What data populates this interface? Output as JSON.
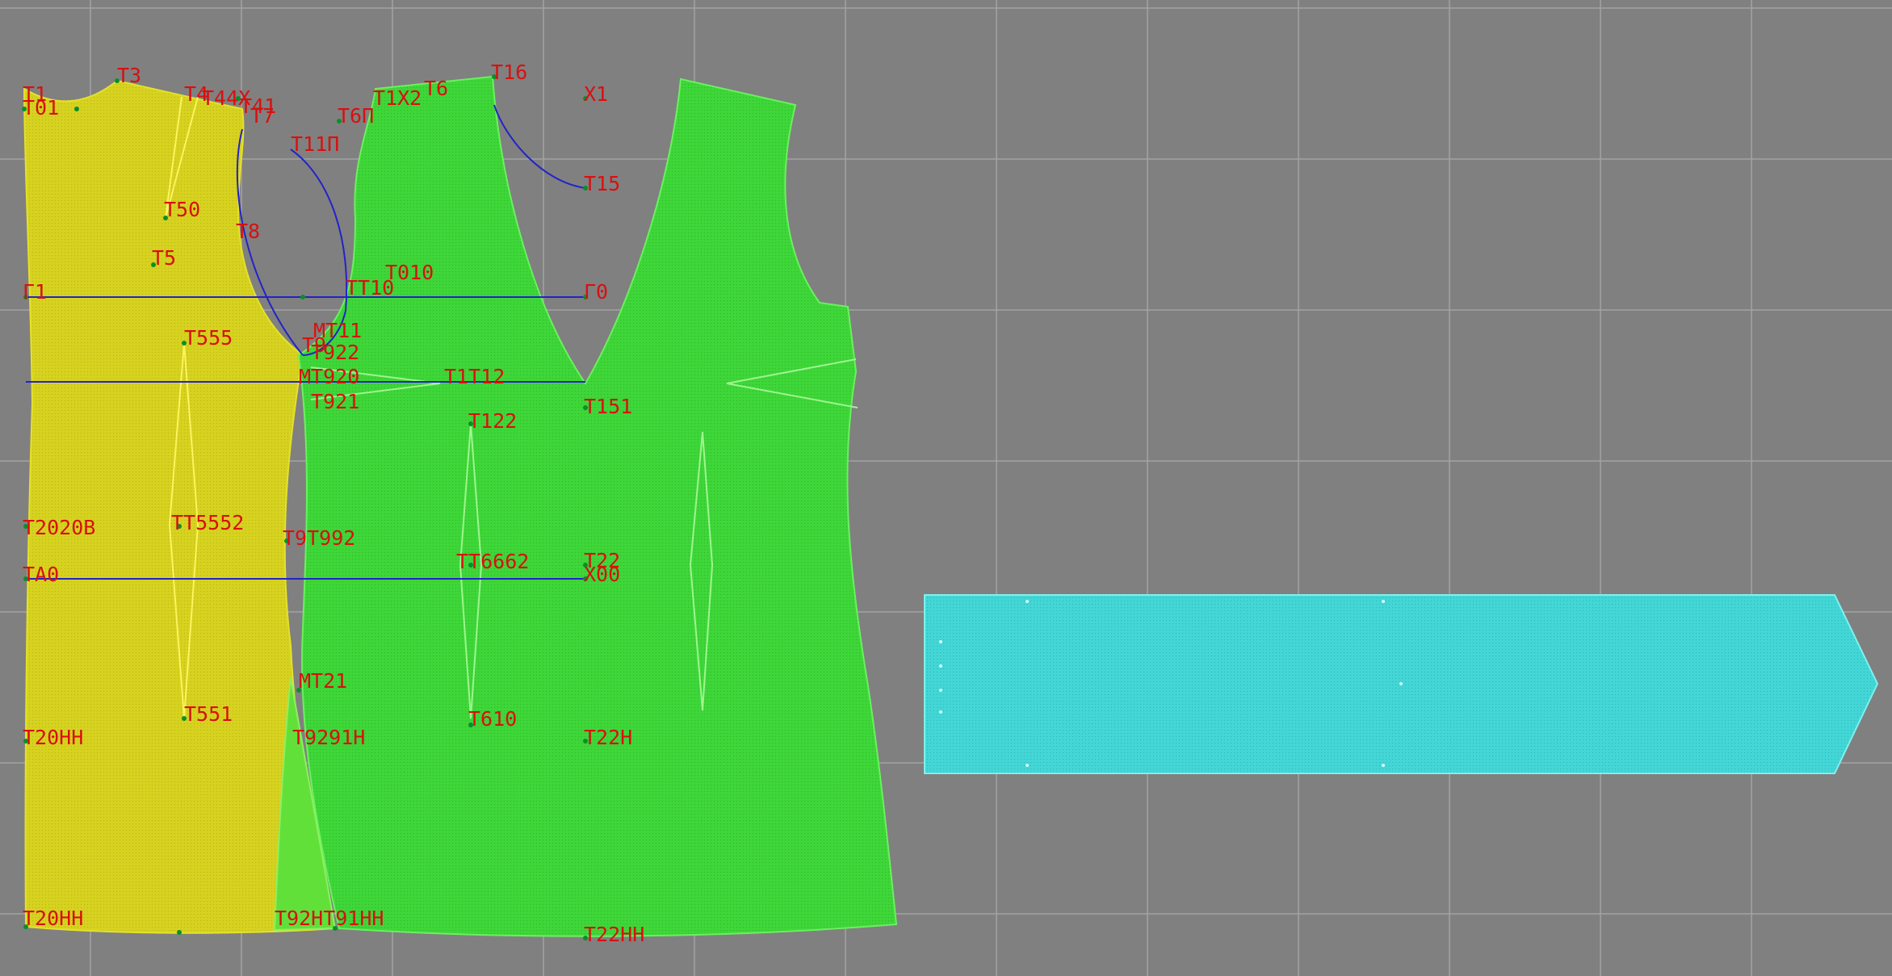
{
  "colors": {
    "background": "#808080",
    "grid": "#a3a3a3",
    "back_piece": "#d6d21f",
    "front_piece": "#3ed638",
    "band_piece": "#43d6d6",
    "construction_line": "#2323c8",
    "label": "#d81010"
  },
  "labels": {
    "t1": "T1",
    "t01": "T01",
    "t3": "T3",
    "t4": "T4",
    "t44": "T44X",
    "t41": "T41",
    "t7": "T7",
    "t2x": "T1X2",
    "t6": "T6",
    "t16": "T16",
    "x1": "X1",
    "t6p": "T6П",
    "t11p": "T11П",
    "t15": "T15",
    "t50": "T50",
    "t8": "T8",
    "t5": "T5",
    "t010": "T010",
    "g1": "Г1",
    "t110": "TT10",
    "g0": "Г0",
    "t555": "T555",
    "mt11": "MT11",
    "t9": "T9",
    "t922": "T922",
    "t920": "MT920",
    "t112": "T1T12",
    "t921": "T921",
    "t151": "T151",
    "t122": "T122",
    "t20v": "T2020B",
    "t552": "TT5552",
    "t992": "T9T992",
    "t662": "TT6662",
    "t22": "T22",
    "ta0": "TA0",
    "x00": "X00",
    "mt21": "MT21",
    "t551": "T551",
    "t610": "T610",
    "t20h": "T20HH",
    "t91h": "T9291H",
    "t22h": "T22H",
    "t20hh": "T20HH",
    "t92hh": "T92HT91HH",
    "t22hh": "T22HH"
  }
}
